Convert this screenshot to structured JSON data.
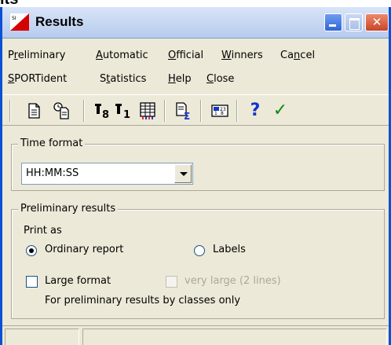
{
  "top_fragment": "lts",
  "window": {
    "title": "Results",
    "buttons": {
      "minimize": "minimize",
      "maximize": "maximize",
      "close": "✕"
    }
  },
  "menu": {
    "row1": [
      "Preliminary",
      "Automatic",
      "Official",
      "Winners",
      "Cancel"
    ],
    "row2": [
      "SPORTident",
      "Statistics",
      "Help",
      "Close"
    ]
  },
  "toolbar": {
    "icons": [
      "page-icon",
      "page-clock-icon",
      "podium-8-icon",
      "podium-1-icon",
      "grid-icon",
      "sum-icon",
      "bracket-icon",
      "help-icon",
      "check-icon"
    ],
    "help": "?",
    "check": "✓"
  },
  "time_format": {
    "title": "Time format",
    "value": "HH:MM:SS"
  },
  "preliminary_results": {
    "title": "Preliminary results",
    "print_as": "Print as",
    "ordinary_report": "Ordinary report",
    "labels": "Labels",
    "selected": "ordinary_report",
    "large_format": "Large format",
    "very_large": "very large (2 lines)",
    "note": "For preliminary results by classes only"
  },
  "colors": {
    "window_bg": "#ece9d8",
    "frame_blue": "#0b51d4",
    "check_green": "#118811",
    "help_blue": "#1336c8"
  }
}
